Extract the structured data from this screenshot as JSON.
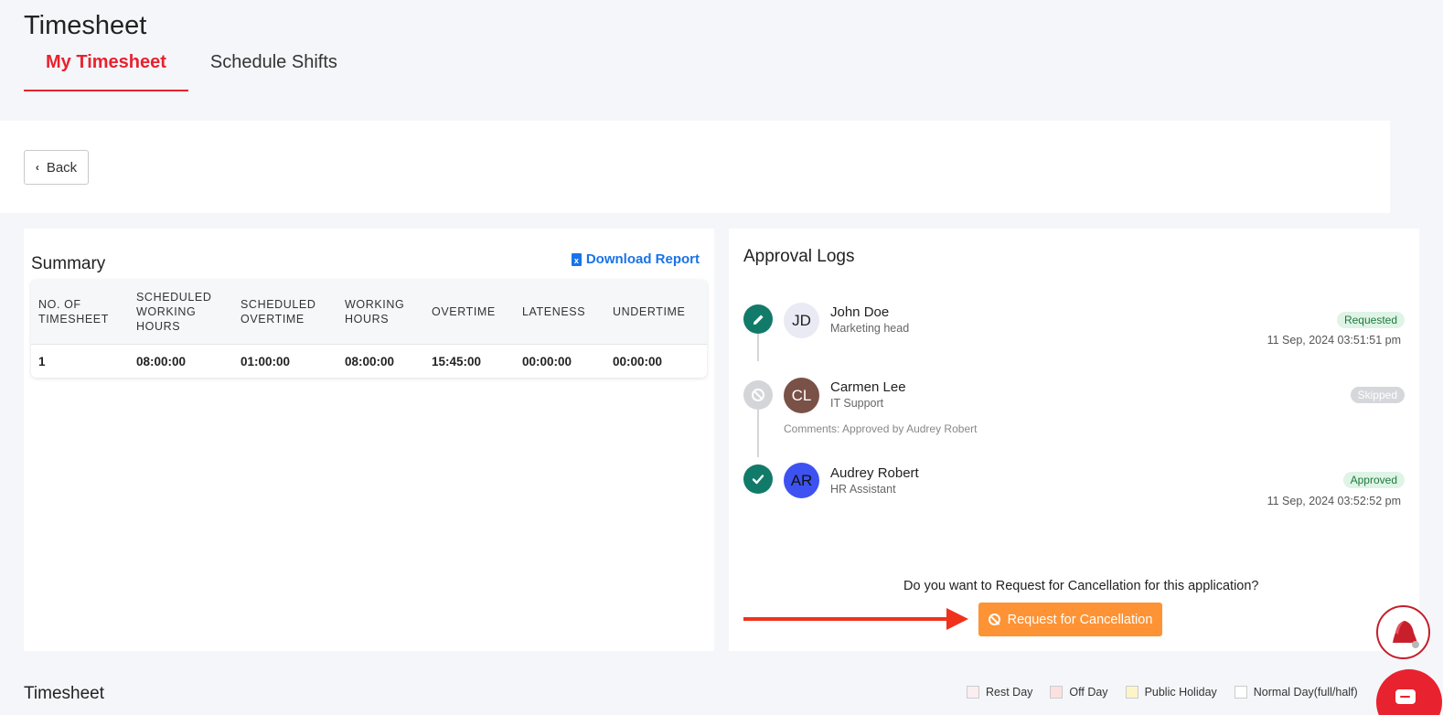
{
  "page": {
    "title": "Timesheet"
  },
  "tabs": [
    {
      "label": "My Timesheet",
      "active": true
    },
    {
      "label": "Schedule Shifts",
      "active": false
    }
  ],
  "toolbar": {
    "back_label": "Back"
  },
  "summary": {
    "title": "Summary",
    "download_label": "Download Report",
    "headers": [
      [
        "NO. OF",
        "TIMESHEET"
      ],
      [
        "SCHEDULED",
        "WORKING",
        "HOURS"
      ],
      [
        "SCHEDULED",
        "OVERTIME"
      ],
      [
        "WORKING",
        "HOURS"
      ],
      [
        "OVERTIME"
      ],
      [
        "LATENESS"
      ],
      [
        "UNDERTIME"
      ]
    ],
    "rows": [
      [
        "1",
        "08:00:00",
        "01:00:00",
        "08:00:00",
        "15:45:00",
        "00:00:00",
        "00:00:00"
      ]
    ]
  },
  "approval": {
    "title": "Approval Logs",
    "logs": [
      {
        "initials": "JD",
        "name": "John Doe",
        "role": "Marketing head",
        "status": "Requested",
        "timestamp": "11 Sep, 2024 03:51:51 pm",
        "icon": "pencil-icon",
        "comment": ""
      },
      {
        "initials": "CL",
        "name": "Carmen Lee",
        "role": "IT Support",
        "status": "Skipped",
        "timestamp": "",
        "icon": "ban-icon",
        "comment": "Comments: Approved by Audrey Robert"
      },
      {
        "initials": "AR",
        "name": "Audrey Robert",
        "role": "HR Assistant",
        "status": "Approved",
        "timestamp": "11 Sep, 2024 03:52:52 pm",
        "icon": "check-icon",
        "comment": ""
      }
    ],
    "cancel_question": "Do you want to Request for Cancellation for this application?",
    "cancel_button": "Request for Cancellation"
  },
  "timesheet": {
    "title": "Timesheet",
    "legend": [
      {
        "label": "Rest Day",
        "color": "#fbeef0"
      },
      {
        "label": "Off Day",
        "color": "#fde0e0"
      },
      {
        "label": "Public Holiday",
        "color": "#fdf5c8"
      },
      {
        "label": "Normal Day(full/half)",
        "color": "#ffffff"
      }
    ]
  },
  "colors": {
    "brand_red": "#e8222f",
    "link_blue": "#1a73e8",
    "approval_green": "#127a68",
    "cancel_orange": "#fd9335"
  }
}
